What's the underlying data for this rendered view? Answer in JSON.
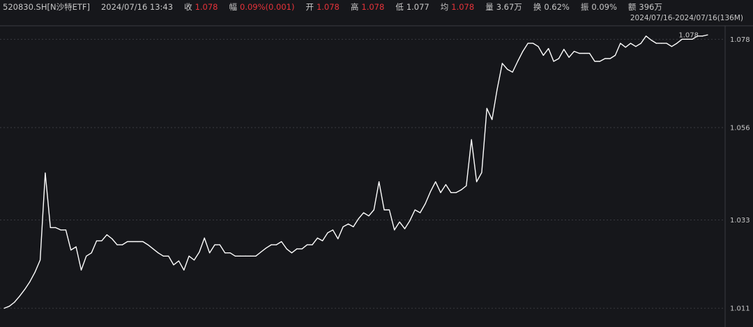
{
  "header": {
    "symbol": "520830.SH[N沙特ETF]",
    "datetime": "2024/07/16 13:43",
    "close_label": "收",
    "close_value": "1.078",
    "change_label": "幅",
    "change_value": "0.09%(0.001)",
    "open_label": "开",
    "open_value": "1.078",
    "high_label": "高",
    "high_value": "1.078",
    "low_label": "低",
    "low_value": "1.077",
    "avg_label": "均",
    "avg_value": "1.078",
    "volume_label": "量",
    "volume_value": "3.67万",
    "turnover_label": "换",
    "turnover_value": "0.62%",
    "amplitude_label": "振",
    "amplitude_value": "0.09%",
    "amount_label": "额",
    "amount_value": "396万",
    "range": "2024/07/16-2024/07/16(136M)"
  },
  "colors": {
    "background": "#16171b",
    "line": "#ffffff",
    "up": "#e8333a",
    "grid": "#3a3b40"
  },
  "chart_data": {
    "type": "line",
    "title": "",
    "xlabel": "",
    "ylabel": "",
    "ylim": [
      1.0105,
      1.0791
    ],
    "y_ticks": [
      "1.078",
      "1.056",
      "1.033",
      "1.011"
    ],
    "last_value_label": "1.078",
    "grid": "horizontal dashed",
    "series": [
      {
        "name": "",
        "values": [
          1.011,
          1.0115,
          1.0125,
          1.014,
          1.0157,
          1.0176,
          1.02,
          1.023,
          1.0447,
          1.0311,
          1.0311,
          1.0305,
          1.0305,
          1.0255,
          1.0263,
          1.0205,
          1.024,
          1.0248,
          1.0278,
          1.0278,
          1.0293,
          1.0283,
          1.0268,
          1.0268,
          1.0276,
          1.0276,
          1.0276,
          1.0276,
          1.0268,
          1.0258,
          1.0248,
          1.024,
          1.024,
          1.0218,
          1.0228,
          1.0205,
          1.024,
          1.023,
          1.025,
          1.0285,
          1.0248,
          1.0268,
          1.0268,
          1.0248,
          1.0248,
          1.024,
          1.024,
          1.024,
          1.024,
          1.024,
          1.025,
          1.026,
          1.0268,
          1.0268,
          1.0276,
          1.0258,
          1.0248,
          1.0258,
          1.0258,
          1.0268,
          1.0268,
          1.0285,
          1.0278,
          1.0298,
          1.0305,
          1.0283,
          1.0313,
          1.032,
          1.0313,
          1.0333,
          1.0348,
          1.034,
          1.0355,
          1.0425,
          1.0355,
          1.0355,
          1.0305,
          1.0325,
          1.0308,
          1.0328,
          1.0355,
          1.0348,
          1.037,
          1.04,
          1.0425,
          1.0398,
          1.0418,
          1.0398,
          1.0398,
          1.0405,
          1.0415,
          1.053,
          1.0425,
          1.0448,
          1.0608,
          1.058,
          1.0655,
          1.072,
          1.0705,
          1.0698,
          1.0725,
          1.075,
          1.077,
          1.077,
          1.0762,
          1.074,
          1.0757,
          1.0725,
          1.0732,
          1.0755,
          1.0735,
          1.075,
          1.0745,
          1.0745,
          1.0745,
          1.0725,
          1.0725,
          1.0732,
          1.0732,
          1.074,
          1.077,
          1.076,
          1.077,
          1.0762,
          1.077,
          1.0788,
          1.0778,
          1.077,
          1.077,
          1.077,
          1.0762,
          1.077,
          1.078,
          1.078,
          1.078,
          1.0788,
          1.0788,
          1.0791
        ]
      }
    ]
  }
}
